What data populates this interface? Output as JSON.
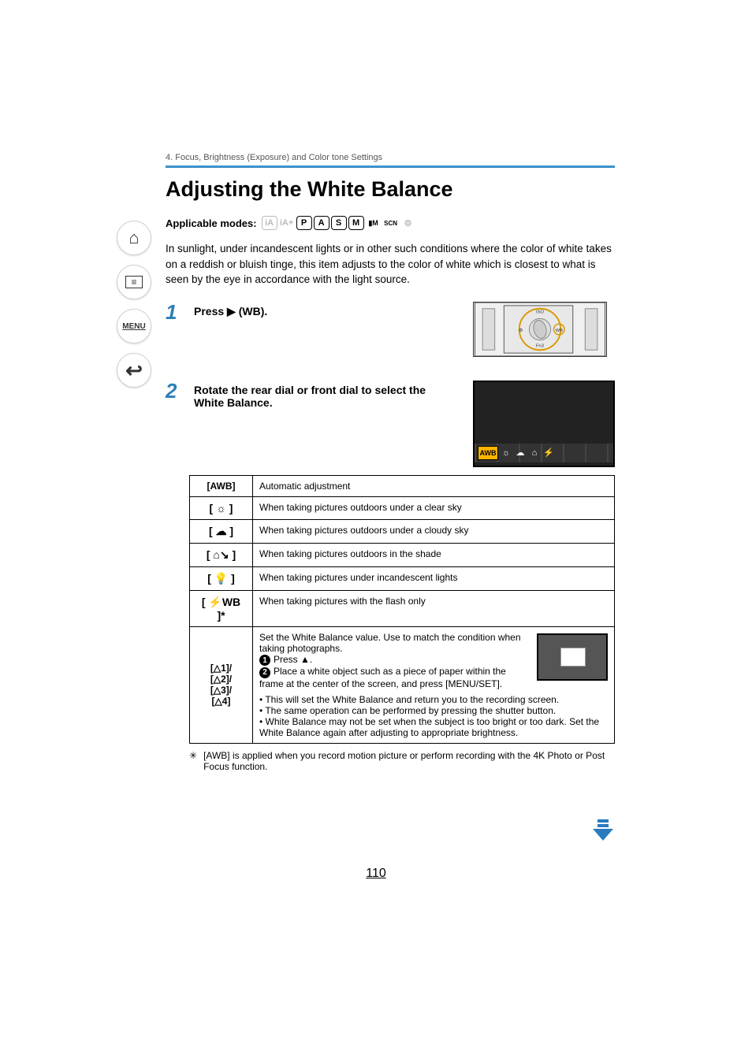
{
  "sidebar": {
    "home": "⌂",
    "toc": "≡",
    "menu": "MENU",
    "back": "↩"
  },
  "breadcrumb": "4. Focus, Brightness (Exposure) and Color tone Settings",
  "title": "Adjusting the White Balance",
  "applicable_label": "Applicable modes:",
  "modes": [
    "iA",
    "iA+",
    "P",
    "A",
    "S",
    "M",
    "▮M",
    "SCN",
    "⚙"
  ],
  "modes_disabled": [
    true,
    true,
    false,
    false,
    false,
    false,
    false,
    false,
    true
  ],
  "intro": "In sunlight, under incandescent lights or in other such conditions where the color of white takes on a reddish or bluish tinge, this item adjusts to the color of white which is closest to what is seen by the eye in accordance with the light source.",
  "step1": {
    "num": "1",
    "text_a": "Press ▶ (",
    "text_b": "WB",
    "text_c": ")."
  },
  "step2": {
    "num": "2",
    "text": "Rotate the rear dial or front dial to select the White Balance."
  },
  "dial_labels": {
    "top": "ISO",
    "left": "⚙",
    "right": "WB",
    "bottom": "Fn3"
  },
  "wb_selector": {
    "label": "WB",
    "selected": "AWB",
    "opts": [
      "☼",
      "☁",
      "⌂",
      "⚡"
    ]
  },
  "table": {
    "rows": [
      {
        "key": "[AWB]",
        "desc": "Automatic adjustment"
      },
      {
        "key": "[ ☼ ]",
        "desc": "When taking pictures outdoors under a clear sky"
      },
      {
        "key": "[ ☁ ]",
        "desc": "When taking pictures outdoors under a cloudy sky"
      },
      {
        "key": "[ ⌂↘ ]",
        "desc": "When taking pictures outdoors in the shade"
      },
      {
        "key": "[ 💡 ]",
        "desc": "When taking pictures under incandescent lights"
      },
      {
        "key": "[ ⚡WB ]*",
        "desc": "When taking pictures with the flash only"
      }
    ],
    "custom": {
      "key_parts": [
        "[△1]/",
        "[△2]/",
        "[△3]/",
        "[△4]"
      ],
      "intro": "Set the White Balance value. Use to match the condition when taking photographs.",
      "s1": "Press ▲.",
      "s2": "Place a white object such as a piece of paper within the frame at the center of the screen, and press [MENU/SET].",
      "b1": "• This will set the White Balance and return you to the recording screen.",
      "b2": "• The same operation can be performed by pressing the shutter button.",
      "b3": "• White Balance may not be set when the subject is too bright or too dark. Set the White Balance again after adjusting to appropriate brightness."
    }
  },
  "footnote_star": "✳",
  "footnote": "[AWB] is applied when you record motion picture or perform recording with the 4K Photo or Post Focus function.",
  "pagenum": "110"
}
